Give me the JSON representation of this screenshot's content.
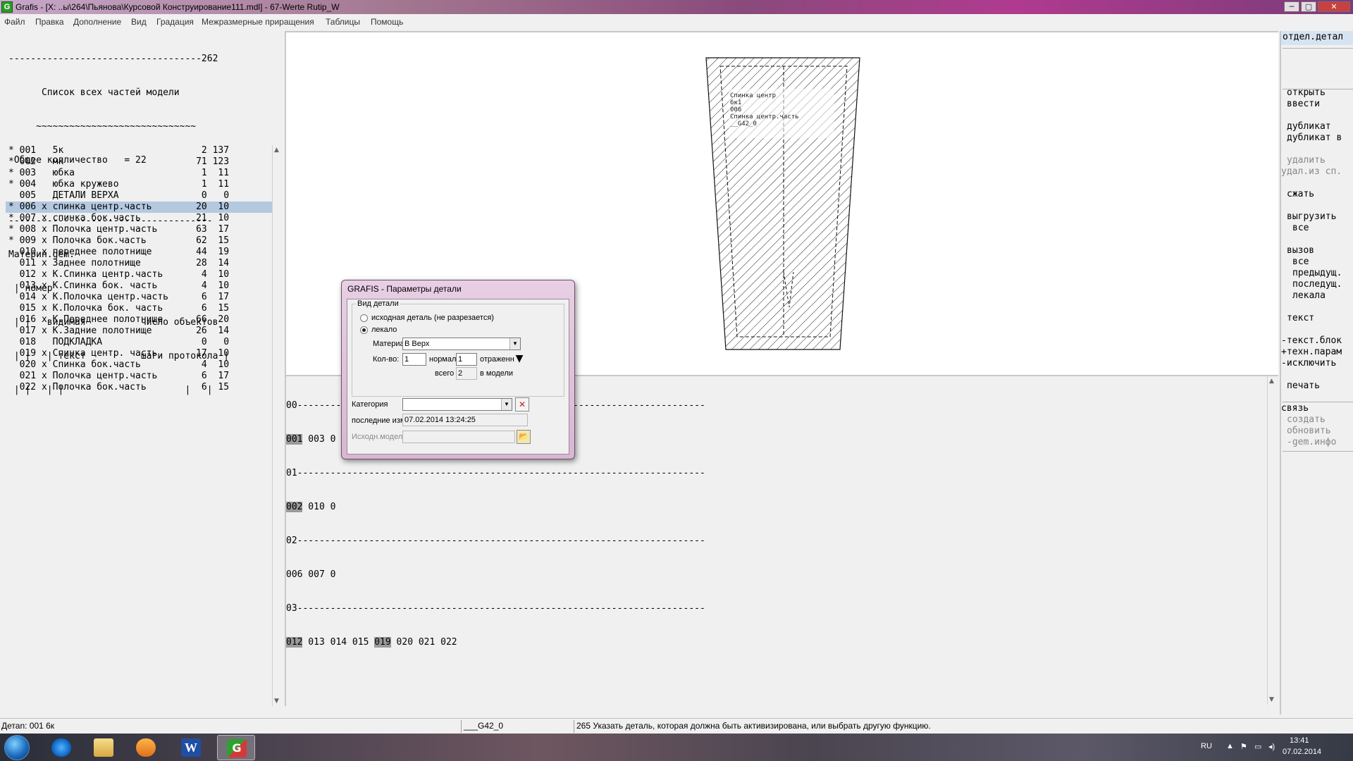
{
  "window": {
    "title": "Grafis - [X: ..ы\\264\\Пьянова\\Курсовой Конструирование111.mdl] - 67-Werte Rutip_W",
    "icon_label": "G",
    "minimize": "─",
    "maximize": "▢",
    "close": "✕"
  },
  "menu": [
    "Файл",
    "Правка",
    "Дополнение",
    "Вид",
    "Градация",
    "Межразмерные приращения",
    "Таблицы",
    "Помощь"
  ],
  "left_panel": {
    "header_lines": [
      "-----------------------------------262",
      "      Список всех частей модели",
      "     ~~~~~~~~~~~~~~~~~~~~~~~~~~~~~",
      " Общее колличество   = 22",
      "",
      "-------------------------------------",
      "Материн.gem.",
      " | номер",
      " | |   видимая          число объектов",
      " | |   | текст          шаги протокола |",
      " | |   | |                      |   |"
    ],
    "parts": [
      {
        "mark": "*",
        "num": "001",
        "x": " ",
        "name": "5к",
        "steps": "2",
        "proto": "137"
      },
      {
        "mark": "*",
        "num": "002",
        "x": " ",
        "name": "мк",
        "steps": "71",
        "proto": "123"
      },
      {
        "mark": "*",
        "num": "003",
        "x": " ",
        "name": "юбка",
        "steps": "1",
        "proto": "11"
      },
      {
        "mark": "*",
        "num": "004",
        "x": " ",
        "name": "юбка кружево",
        "steps": "1",
        "proto": "11"
      },
      {
        "mark": " ",
        "num": "005",
        "x": " ",
        "name": "ДЕТАЛИ ВЕРХА",
        "steps": "0",
        "proto": "0"
      },
      {
        "mark": "*",
        "num": "006",
        "x": "x",
        "name": "спинка центр.часть",
        "steps": "20",
        "proto": "10"
      },
      {
        "mark": "*",
        "num": "007",
        "x": "x",
        "name": "спинка бок.часть",
        "steps": "21",
        "proto": "10"
      },
      {
        "mark": "*",
        "num": "008",
        "x": "x",
        "name": "Полочка центр.часть",
        "steps": "63",
        "proto": "17"
      },
      {
        "mark": "*",
        "num": "009",
        "x": "x",
        "name": "Полочка бок.часть",
        "steps": "62",
        "proto": "15"
      },
      {
        "mark": " ",
        "num": "010",
        "x": "x",
        "name": "переднее полотнище",
        "steps": "44",
        "proto": "19"
      },
      {
        "mark": " ",
        "num": "011",
        "x": "x",
        "name": "Заднее полотнище",
        "steps": "28",
        "proto": "14"
      },
      {
        "mark": " ",
        "num": "012",
        "x": "x",
        "name": "К.Спинка центр.часть",
        "steps": "4",
        "proto": "10"
      },
      {
        "mark": " ",
        "num": "013",
        "x": "x",
        "name": "К.Спинка бок. часть",
        "steps": "4",
        "proto": "10"
      },
      {
        "mark": " ",
        "num": "014",
        "x": "x",
        "name": "К.Полочка центр.часть",
        "steps": "6",
        "proto": "17"
      },
      {
        "mark": " ",
        "num": "015",
        "x": "x",
        "name": "К.Полочка бок. часть",
        "steps": "6",
        "proto": "15"
      },
      {
        "mark": " ",
        "num": "016",
        "x": "x",
        "name": "К.Переднее полотнище",
        "steps": "66",
        "proto": "20"
      },
      {
        "mark": " ",
        "num": "017",
        "x": "x",
        "name": "К.Задние полотнище",
        "steps": "26",
        "proto": "14"
      },
      {
        "mark": " ",
        "num": "018",
        "x": " ",
        "name": "ПОДКЛАДКА",
        "steps": "0",
        "proto": "0"
      },
      {
        "mark": " ",
        "num": "019",
        "x": "x",
        "name": "Спинка центр. часть",
        "steps": "17",
        "proto": "10"
      },
      {
        "mark": " ",
        "num": "020",
        "x": "x",
        "name": "Спинка бок.часть",
        "steps": "4",
        "proto": "10"
      },
      {
        "mark": " ",
        "num": "021",
        "x": "x",
        "name": "Полочка центр.часть",
        "steps": "6",
        "proto": "17"
      },
      {
        "mark": " ",
        "num": "022",
        "x": "x",
        "name": "Полочка бок.часть",
        "steps": "6",
        "proto": "15"
      }
    ],
    "selected_num": "006"
  },
  "drawing": {
    "label_lines": [
      "Спинка центр",
      "6к1",
      "006",
      "Спинка центр.часть",
      "__G42_0"
    ]
  },
  "protocol": {
    "lines": [
      "00--------------------------------------------------------------------------",
      "001 003 0",
      "01--------------------------------------------------------------------------",
      "002 010 0",
      "02--------------------------------------------------------------------------",
      "006 007 0",
      "03--------------------------------------------------------------------------",
      "012 013 014 015 019 020 021 022"
    ]
  },
  "right_panel": {
    "header": "отдел.детал",
    "commands": [
      {
        "text": "открыть",
        "enabled": true
      },
      {
        "text": "ввести",
        "enabled": true
      },
      {
        "text": "дубликат",
        "enabled": true
      },
      {
        "text": "дубликат в",
        "enabled": true
      },
      {
        "text": "удалить",
        "enabled": false
      },
      {
        "text": "удал.из сп.",
        "enabled": false
      },
      {
        "text": "сжать",
        "enabled": true
      },
      {
        "text": "выгрузить",
        "enabled": true
      },
      {
        "text": "все",
        "enabled": true
      },
      {
        "text": "вызов",
        "enabled": true
      },
      {
        "text": "все",
        "enabled": true
      },
      {
        "text": "предыдущ.",
        "enabled": true
      },
      {
        "text": "последущ.",
        "enabled": true
      },
      {
        "text": "лекала",
        "enabled": true
      },
      {
        "text": "текст",
        "enabled": true
      },
      {
        "text": "-текст.блок",
        "enabled": true
      },
      {
        "text": "+техн.парам",
        "enabled": true
      },
      {
        "text": "-исключить",
        "enabled": true
      },
      {
        "text": "печать",
        "enabled": true
      },
      {
        "text": "связь",
        "enabled": true
      },
      {
        "text": "создать",
        "enabled": false
      },
      {
        "text": "обновить",
        "enabled": false
      },
      {
        "text": "-gem.инфо",
        "enabled": false
      }
    ]
  },
  "dialog": {
    "title": "GRAFIS - Параметры детали",
    "group_label": "Вид детали",
    "radio_source": "исходная деталь (не разрезается)",
    "radio_pattern": "лекало",
    "selected_radio": "pattern",
    "material_label": "Материал",
    "material_value": "В Верх",
    "qty_label": "Кол-во:",
    "qty_normal_value": "1",
    "normal_label": "нормаль",
    "qty_mirror_value": "1",
    "mirror_label": "отраженн",
    "total_label": "всего",
    "total_value": "2",
    "in_model_label": "в модели",
    "category_label": "Категория",
    "category_value": "",
    "last_change_label": "последние изм.",
    "last_change_value": "07.02.2014  13:24:25",
    "source_model_label": "Исходн.модель",
    "source_model_value": ""
  },
  "status": {
    "part": "Детаn: 001  6к",
    "layer": "___G42_0",
    "message": "265 Указать деталь, которая должна быть активизирована, или выбрать другую функцию."
  },
  "taskbar": {
    "apps": [
      "start-button",
      "internet-explorer",
      "file-explorer",
      "media-player",
      "word",
      "grafis"
    ],
    "active_app": "grafis",
    "lang": "RU",
    "time": "13:41",
    "date": "07.02.2014"
  },
  "colors": {
    "selection": "#b4c8e0",
    "title_gradient_start": "#c7a7c9",
    "dialog_frame": "#e8cfe4"
  }
}
